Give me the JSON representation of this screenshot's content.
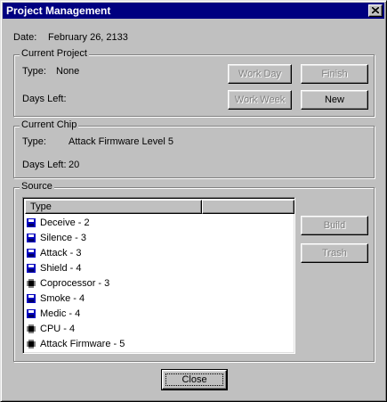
{
  "window": {
    "title": "Project Management"
  },
  "date": {
    "label": "Date:",
    "value": "February 26, 2133"
  },
  "current_project": {
    "group_label": "Current Project",
    "type_label": "Type:",
    "type_value": "None",
    "days_left_label": "Days Left:",
    "days_left_value": "",
    "buttons": {
      "work_day": "Work Day",
      "finish": "Finish",
      "work_week": "Work Week",
      "new": "New"
    }
  },
  "current_chip": {
    "group_label": "Current Chip",
    "type_label": "Type:",
    "type_value": "Attack Firmware Level 5",
    "days_left_label": "Days Left:",
    "days_left_value": "20"
  },
  "source": {
    "group_label": "Source",
    "columns": [
      "Type",
      ""
    ],
    "items": [
      {
        "label": "Deceive - 2",
        "icon": "floppy-disk-icon"
      },
      {
        "label": "Silence - 3",
        "icon": "floppy-disk-icon"
      },
      {
        "label": "Attack - 3",
        "icon": "floppy-disk-icon"
      },
      {
        "label": "Shield - 4",
        "icon": "floppy-disk-icon"
      },
      {
        "label": "Coprocessor - 3",
        "icon": "chip-icon"
      },
      {
        "label": "Smoke - 4",
        "icon": "floppy-disk-icon"
      },
      {
        "label": "Medic - 4",
        "icon": "floppy-disk-icon"
      },
      {
        "label": "CPU - 4",
        "icon": "chip-icon"
      },
      {
        "label": "Attack Firmware - 5",
        "icon": "chip-icon"
      }
    ],
    "buttons": {
      "build": "Build",
      "trash": "Trash"
    }
  },
  "footer": {
    "close": "Close"
  },
  "colors": {
    "titlebar": "#000080",
    "face": "#c0c0c0",
    "disk_icon": "#0000c0"
  }
}
